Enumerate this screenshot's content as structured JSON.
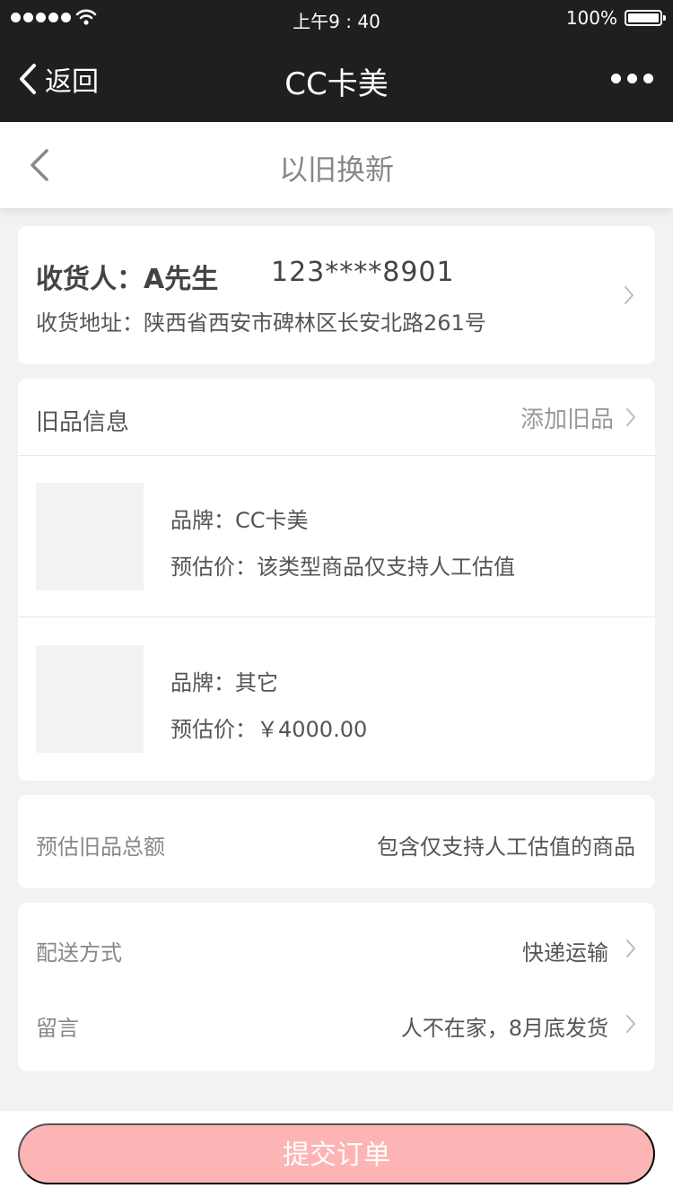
{
  "status_bar": {
    "time": "上午9 : 40",
    "battery": "100%",
    "icons": [
      "signal-dots-icon",
      "wifi-icon",
      "battery-icon"
    ]
  },
  "nav": {
    "back_label": "返回",
    "title": "CC卡美",
    "icons": [
      "chevron-left-icon",
      "more-icon"
    ]
  },
  "page": {
    "title": "以旧换新",
    "icons": [
      "chevron-left-icon"
    ]
  },
  "address": {
    "recipient_label": "收货人：",
    "recipient_name": "A先生",
    "phone": "123****8901",
    "address_line": "收货地址：陕西省西安市碑林区长安北路261号"
  },
  "old_items": {
    "title": "旧品信息",
    "add_label": "添加旧品",
    "items": [
      {
        "brand": "品牌：CC卡美",
        "price": "预估价：该类型商品仅支持人工估值"
      },
      {
        "brand": "品牌：其它",
        "price": "预估价：￥4000.00"
      }
    ]
  },
  "estimate": {
    "label": "预估旧品总额",
    "value": "包含仅支持人工估值的商品"
  },
  "options": {
    "delivery_label": "配送方式",
    "delivery_value": "快递运输",
    "message_label": "留言",
    "message_value": "人不在家，8月底发货"
  },
  "footer": {
    "submit_label": "提交订单"
  },
  "colors": {
    "nav_bg": "#1f1f1f",
    "page_bg": "#f2f2f2",
    "submit_bg": "#fcb4b4"
  }
}
